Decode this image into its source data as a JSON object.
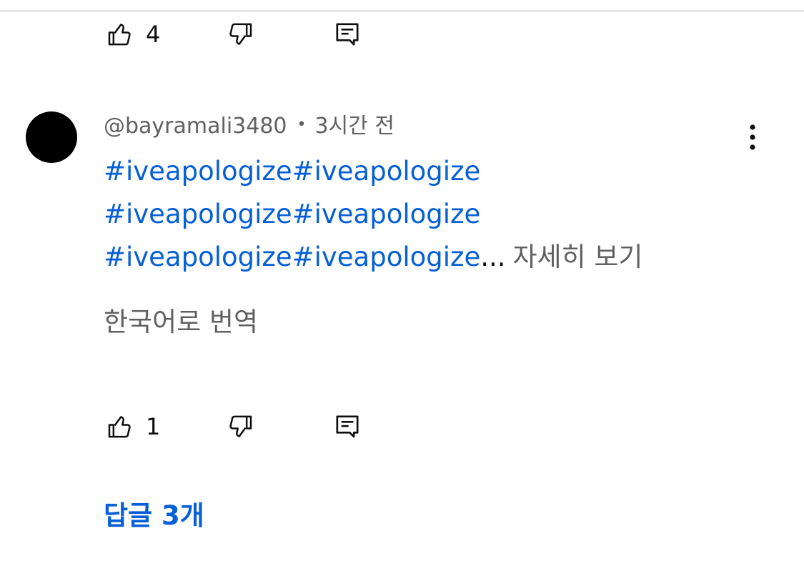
{
  "previous_comment": {
    "like_count": "4"
  },
  "comment": {
    "author": "@bayramali3480",
    "separator": "•",
    "time": "3시간 전",
    "lines": [
      [
        "#iveapologize",
        "#iveapologize"
      ],
      [
        "#iveapologize",
        "#iveapologize"
      ],
      [
        "#iveapologize",
        "#iveapologize"
      ]
    ],
    "ellipsis": "...",
    "read_more": "자세히 보기",
    "translate": "한국어로 번역",
    "like_count": "1",
    "replies": "답글 3개"
  },
  "icons": {
    "like": "thumbs-up-icon",
    "dislike": "thumbs-down-icon",
    "reply": "comment-icon",
    "more": "more-vertical-icon"
  },
  "colors": {
    "link": "#065fd4",
    "secondary_text": "#606060",
    "primary_text": "#0f0f0f",
    "divider": "#e5e5e5",
    "avatar": "#000000"
  }
}
